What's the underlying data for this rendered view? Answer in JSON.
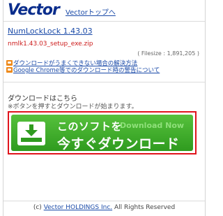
{
  "header": {
    "logo": "Vector",
    "top_link": "Vectorトップへ"
  },
  "software": {
    "name": "NumLockLock 1.43.03",
    "file_name": "nmlk1.43.03_setup_exe.zip",
    "filesize": "( Filesize : 1,891,205 )"
  },
  "notes": [
    {
      "label": "ダウンロードがうまくできない場合の解決方法",
      "icon": "orange-link-icon"
    },
    {
      "label": "Google Chrome等でのダウンロード時の警告について",
      "icon": "orange-link-icon"
    }
  ],
  "download": {
    "heading": "ダウンロードはこちら",
    "note": "※ボタンを押すとダウンロードが始まります。",
    "button_line1": "このソフトを",
    "button_en": "Download Now",
    "button_line2": "今すぐダウンロード",
    "frame_color": "#e0141c",
    "button_color": "#3aa827"
  },
  "footer": {
    "prefix": "(c)",
    "company": "Vector HOLDINGS Inc.",
    "suffix": "All Rights Reserved"
  }
}
